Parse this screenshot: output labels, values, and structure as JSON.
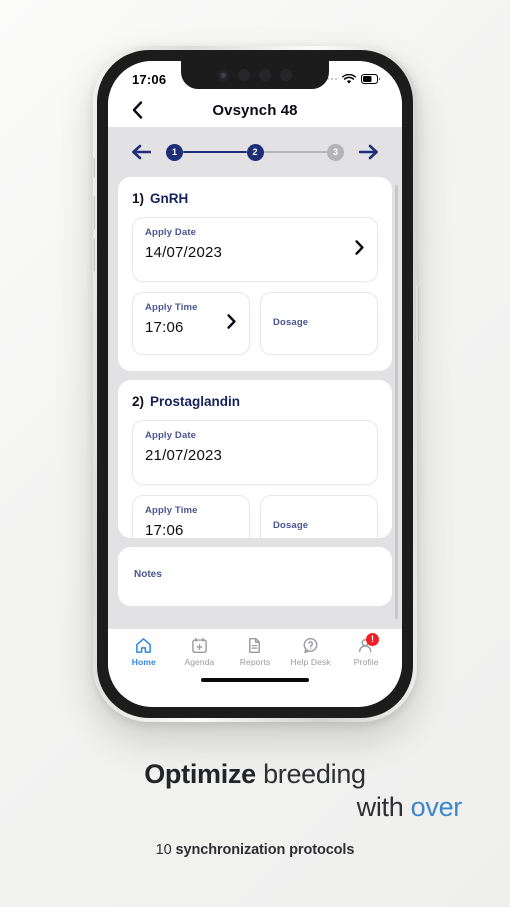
{
  "status_bar": {
    "time": "17:06",
    "signal_icon": "signal-dots-icon",
    "wifi_icon": "wifi-icon",
    "battery_icon": "battery-icon"
  },
  "nav": {
    "back_icon": "chevron-left-icon",
    "title": "Ovsynch 48"
  },
  "stepper": {
    "prev_icon": "arrow-left-icon",
    "next_icon": "arrow-right-icon",
    "steps": [
      {
        "number": "1",
        "state": "active"
      },
      {
        "number": "2",
        "state": "active"
      },
      {
        "number": "3",
        "state": "inactive"
      }
    ],
    "colors": {
      "active": "#1e2f77",
      "inactive": "#b4b4b8"
    }
  },
  "cards": [
    {
      "index": "1)",
      "name": "GnRH",
      "date": {
        "label": "Apply Date",
        "value": "14/07/2023",
        "chevron_icon": "chevron-right-icon"
      },
      "time": {
        "label": "Apply Time",
        "value": "17:06",
        "chevron_icon": "chevron-right-icon"
      },
      "dosage": {
        "label": "Dosage",
        "value": ""
      }
    },
    {
      "index": "2)",
      "name": "Prostaglandin",
      "date": {
        "label": "Apply Date",
        "value": "21/07/2023"
      },
      "time": {
        "label": "Apply Time",
        "value": "17:06"
      },
      "dosage": {
        "label": "Dosage",
        "value": ""
      }
    }
  ],
  "notes": {
    "label": "Notes",
    "value": ""
  },
  "tabs": [
    {
      "label": "Home",
      "icon": "home-icon",
      "active": true,
      "badge": ""
    },
    {
      "label": "Agenda",
      "icon": "calendar-plus-icon",
      "active": false,
      "badge": ""
    },
    {
      "label": "Reports",
      "icon": "document-icon",
      "active": false,
      "badge": ""
    },
    {
      "label": "Help Desk",
      "icon": "question-bubble-icon",
      "active": false,
      "badge": ""
    },
    {
      "label": "Profile",
      "icon": "person-icon",
      "active": false,
      "badge": "!"
    }
  ],
  "caption": {
    "line1_bold": "Optimize",
    "line1_rest": "breeding",
    "line2_rest": "with",
    "line2_blue": "over",
    "sub_number": "10",
    "sub_bold": "synchronization protocols"
  },
  "colors": {
    "navy": "#1e2f77",
    "accent_blue": "#2e86e8",
    "badge_red": "#ed2024",
    "caption_blue": "#3d87c9"
  }
}
